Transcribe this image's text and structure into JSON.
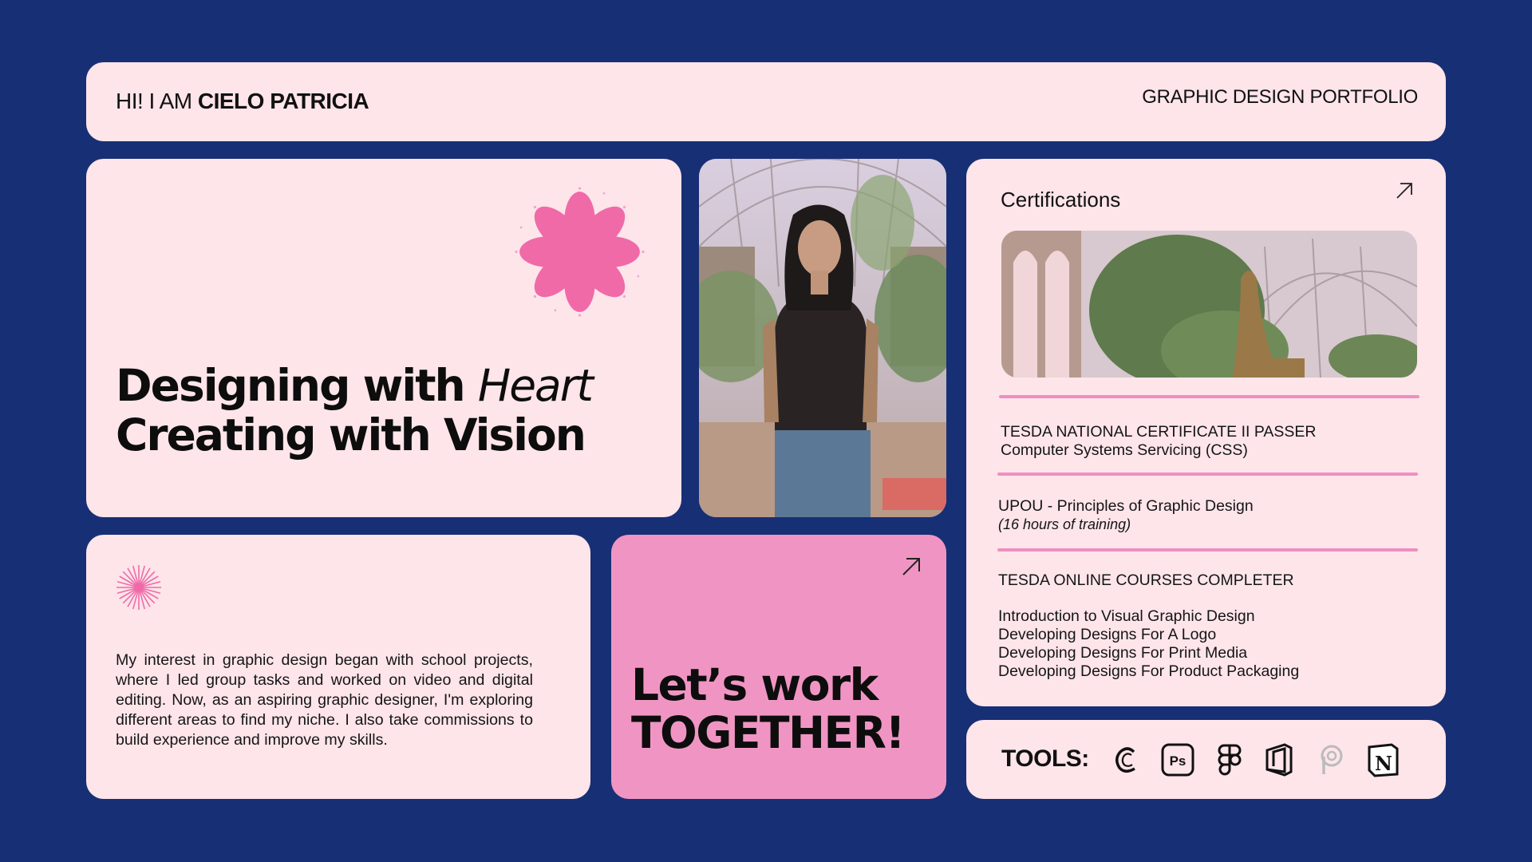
{
  "header": {
    "greeting_prefix": "HI! I AM ",
    "name": "CIELO PATRICIA",
    "subtitle": "GRAPHIC DESIGN PORTFOLIO"
  },
  "hero": {
    "line1_bold": "Designing with ",
    "line1_italic": "Heart",
    "line2": "Creating with Vision"
  },
  "bio": {
    "text": "My interest in graphic design began with school projects, where I led group tasks and worked on video and digital editing. Now, as an aspiring graphic designer, I'm exploring different areas to find my niche. I also take commissions to build experience and improve my skills."
  },
  "cta": {
    "line1": "Let’s work",
    "line2": "TOGETHER!"
  },
  "certifications": {
    "title": "Certifications",
    "items": [
      {
        "line1": "TESDA NATIONAL CERTIFICATE II PASSER",
        "line2": "Computer Systems Servicing (CSS)"
      },
      {
        "line1": "UPOU - Principles of Graphic Design",
        "line2": "(16 hours of training)"
      },
      {
        "line1": "TESDA ONLINE COURSES COMPLETER"
      }
    ],
    "courses": [
      "Introduction to Visual Graphic Design",
      "Developing Designs For A Logo",
      "Developing Designs For Print Media",
      "Developing Designs For Product Packaging"
    ]
  },
  "tools": {
    "label": "TOOLS:",
    "icons": [
      "canva-icon",
      "photoshop-icon",
      "figma-icon",
      "office-icon",
      "picsart-icon",
      "notion-icon"
    ],
    "photoshop_text": "Ps",
    "notion_text": "N"
  },
  "colors": {
    "background": "#172f74",
    "card": "#fde5ea",
    "accent_pink": "#f095c3",
    "flower_pink": "#f06aa8"
  }
}
